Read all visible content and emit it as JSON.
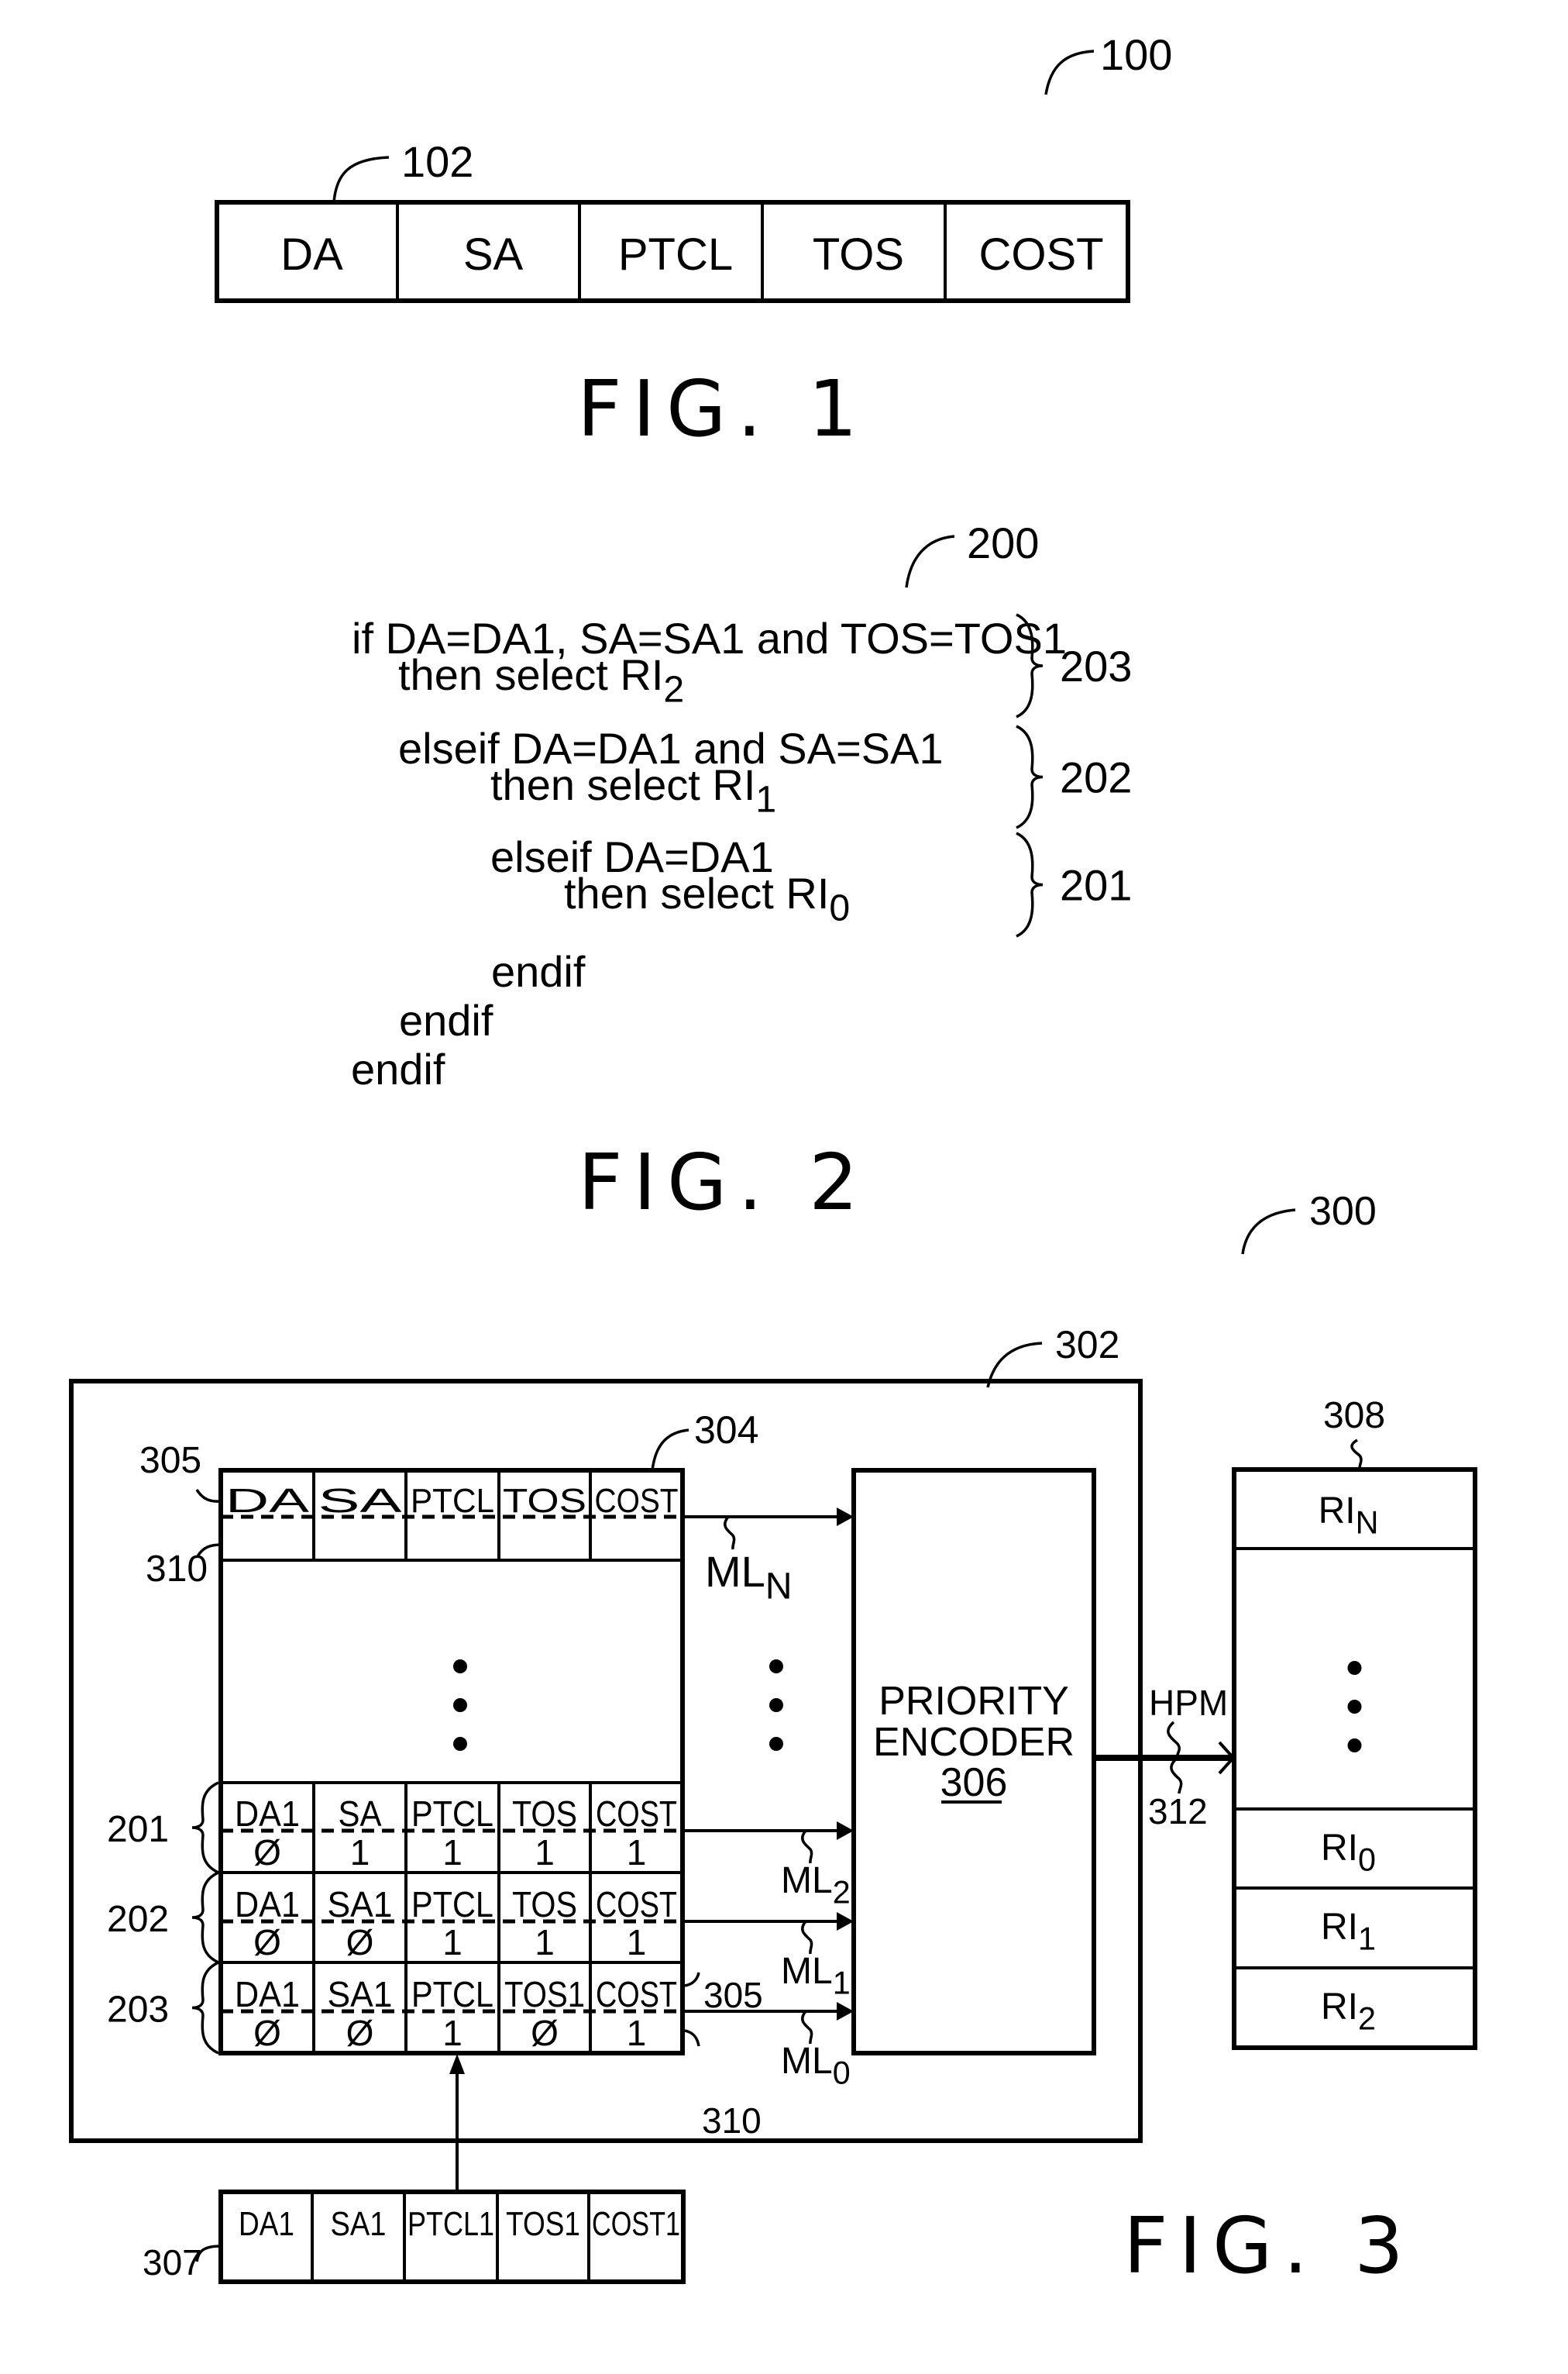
{
  "fig1": {
    "ref_main": "100",
    "ref_field": "102",
    "fields": [
      "DA",
      "SA",
      "PTCL",
      "TOS",
      "COST"
    ],
    "caption": "FIG. 1"
  },
  "fig2": {
    "ref_main": "200",
    "lines": [
      {
        "text": "if DA=DA1, SA=SA1 and TOS=TOS1",
        "sub": ""
      },
      {
        "text": "then select RI",
        "sub": "2"
      },
      {
        "text": "elseif DA=DA1 and SA=SA1",
        "sub": ""
      },
      {
        "text": "then select RI",
        "sub": "1"
      },
      {
        "text": "elseif DA=DA1",
        "sub": ""
      },
      {
        "text": "then select RI",
        "sub": "0"
      },
      {
        "text": "endif",
        "sub": ""
      },
      {
        "text": "endif",
        "sub": ""
      },
      {
        "text": "endif",
        "sub": ""
      }
    ],
    "braces": [
      "203",
      "202",
      "201"
    ],
    "caption": "FIG. 2"
  },
  "fig3": {
    "ref_main": "300",
    "ref_cam": "302",
    "ref_table": "304",
    "ref_data_bit": "305",
    "ref_mask_bit": "310",
    "cam_header_row": [
      "DA",
      "SA",
      "PTCL",
      "TOS",
      "COST"
    ],
    "cam_rows": [
      {
        "label": "201",
        "data": [
          "DA1",
          "SA",
          "PTCL",
          "TOS",
          "COST"
        ],
        "mask": [
          "Ø",
          "1",
          "1",
          "1",
          "1"
        ],
        "match_line": "ML",
        "match_sub": "2"
      },
      {
        "label": "202",
        "data": [
          "DA1",
          "SA1",
          "PTCL",
          "TOS",
          "COST"
        ],
        "mask": [
          "Ø",
          "Ø",
          "1",
          "1",
          "1"
        ],
        "match_line": "ML",
        "match_sub": "1"
      },
      {
        "label": "203",
        "data": [
          "DA1",
          "SA1",
          "PTCL",
          "TOS1",
          "COST"
        ],
        "mask": [
          "Ø",
          "Ø",
          "1",
          "Ø",
          "1"
        ],
        "match_line": "ML",
        "match_sub": "0"
      }
    ],
    "top_match_line": "ML",
    "top_match_sub": "N",
    "encoder": {
      "line1": "PRIORITY",
      "line2": "ENCODER",
      "ref": "306"
    },
    "hpm_label": "HPM",
    "hpm_ref": "312",
    "ri_table": {
      "ref": "308",
      "top": {
        "text": "RI",
        "sub": "N"
      },
      "bottom": [
        {
          "text": "RI",
          "sub": "0"
        },
        {
          "text": "RI",
          "sub": "1"
        },
        {
          "text": "RI",
          "sub": "2"
        }
      ]
    },
    "search_key": {
      "ref": "307",
      "fields": [
        "DA1",
        "SA1",
        "PTCL1",
        "TOS1",
        "COST1"
      ]
    },
    "ref_data_bit_lower": "305",
    "ref_mask_bit_lower": "310",
    "caption": "FIG. 3"
  }
}
